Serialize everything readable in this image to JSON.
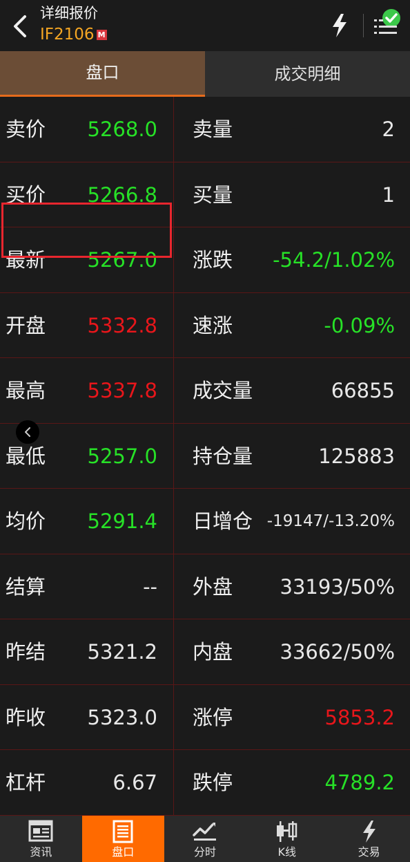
{
  "header": {
    "title": "详细报价",
    "code": "IF2106",
    "badge": "M"
  },
  "tabs": [
    {
      "label": "盘口",
      "active": true
    },
    {
      "label": "成交明细",
      "active": false
    }
  ],
  "rows": [
    {
      "left_label": "卖价",
      "left_value": "5268.0",
      "left_color": "green",
      "right_label": "卖量",
      "right_value": "2",
      "right_color": "white"
    },
    {
      "left_label": "买价",
      "left_value": "5266.8",
      "left_color": "green",
      "right_label": "买量",
      "right_value": "1",
      "right_color": "white"
    },
    {
      "left_label": "最新",
      "left_value": "5267.0",
      "left_color": "green",
      "right_label": "涨跌",
      "right_value": "-54.2/1.02%",
      "right_color": "green"
    },
    {
      "left_label": "开盘",
      "left_value": "5332.8",
      "left_color": "red",
      "right_label": "速涨",
      "right_value": "-0.09%",
      "right_color": "green"
    },
    {
      "left_label": "最高",
      "left_value": "5337.8",
      "left_color": "red",
      "right_label": "成交量",
      "right_value": "66855",
      "right_color": "white"
    },
    {
      "left_label": "最低",
      "left_value": "5257.0",
      "left_color": "green",
      "right_label": "持仓量",
      "right_value": "125883",
      "right_color": "white"
    },
    {
      "left_label": "均价",
      "left_value": "5291.4",
      "left_color": "green",
      "right_label": "日增仓",
      "right_value": "-19147/-13.20%",
      "right_color": "white"
    },
    {
      "left_label": "结算",
      "left_value": "--",
      "left_color": "white",
      "right_label": "外盘",
      "right_value": "33193/50%",
      "right_color": "white"
    },
    {
      "left_label": "昨结",
      "left_value": "5321.2",
      "left_color": "white",
      "right_label": "内盘",
      "right_value": "33662/50%",
      "right_color": "white"
    },
    {
      "left_label": "昨收",
      "left_value": "5323.0",
      "left_color": "white",
      "right_label": "涨停",
      "right_value": "5853.2",
      "right_color": "red"
    },
    {
      "left_label": "杠杆",
      "left_value": "6.67",
      "left_color": "white",
      "right_label": "跌停",
      "right_value": "4789.2",
      "right_color": "green"
    }
  ],
  "bottom_nav": [
    {
      "label": "资讯",
      "icon": "news-icon",
      "active": false
    },
    {
      "label": "盘口",
      "icon": "order-book-icon",
      "active": true
    },
    {
      "label": "分时",
      "icon": "time-share-icon",
      "active": false
    },
    {
      "label": "K线",
      "icon": "candlestick-icon",
      "active": false
    },
    {
      "label": "交易",
      "icon": "trade-bolt-icon",
      "active": false
    }
  ],
  "colors": {
    "green": "#27e127",
    "red": "#e8161b",
    "accent": "#ff6a00",
    "tab_active": "#6b4d36"
  }
}
